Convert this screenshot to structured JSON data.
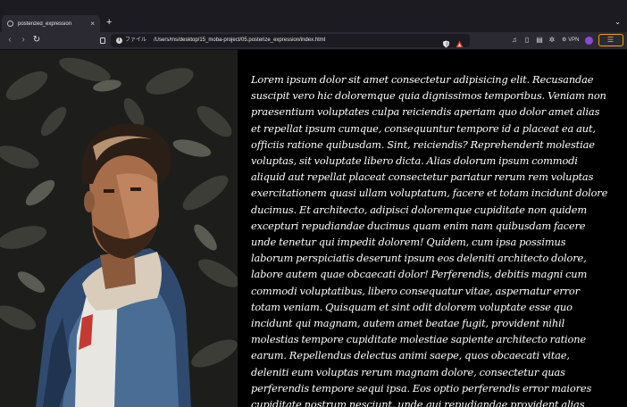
{
  "tab": {
    "title": "posterized_expression",
    "close_glyph": "×",
    "new_tab_glyph": "+",
    "list_glyph": "⌄"
  },
  "toolbar": {
    "back_glyph": "‹",
    "forward_glyph": "›",
    "reload_glyph": "↻",
    "url_label": "ファイル",
    "url": "/Users/ms/desktop/15_moba-project/05.posterize_expression/index.html",
    "vpn_label": "VPN",
    "menu_glyph": "☰"
  },
  "icons": {
    "site_info": "info-icon",
    "shield": "brave-shield-icon",
    "rewards": "brave-rewards-icon",
    "wallet": "wallet-icon",
    "accent": "#e7a324"
  },
  "article": {
    "text": "Lorem ipsum dolor sit amet consectetur adipisicing elit. Recusandae suscipit vero hic doloremque quia dignissimos temporibus. Veniam non praesentium voluptates culpa reiciendis aperiam quo dolor amet alias et repellat ipsum cumque, consequuntur tempore id a placeat ea aut, officiis ratione quibusdam. Sint, reiciendis? Reprehenderit molestiae voluptas, sit voluptate libero dicta. Alias dolorum ipsum commodi aliquid aut repellat placeat consectetur pariatur rerum rem voluptas exercitationem quasi ullam voluptatum, facere et totam incidunt dolore ducimus. Et architecto, adipisci doloremque cupiditate non quidem excepturi repudiandae ducimus quam enim nam quibusdam facere unde tenetur qui impedit dolorem! Quidem, cum ipsa possimus laborum perspiciatis deserunt ipsum eos deleniti architecto dolore, labore autem quae obcaecati dolor! Perferendis, debitis magni cum commodi voluptatibus, libero consequatur vitae, aspernatur error totam veniam. Quisquam et sint odit dolorem voluptate esse quo incidunt qui magnam, autem amet beatae fugit, provident nihil molestias tempore cupiditate molestiae sapiente architecto ratione earum. Repellendus delectus animi saepe, quos obcaecati vitae, deleniti eum voluptas rerum magnam dolore, consectetur quas perferendis tempore sequi ipsa. Eos optio perferendis error maiores cupiditate nostrum nesciunt, unde qui repudiandae provident alias"
  }
}
